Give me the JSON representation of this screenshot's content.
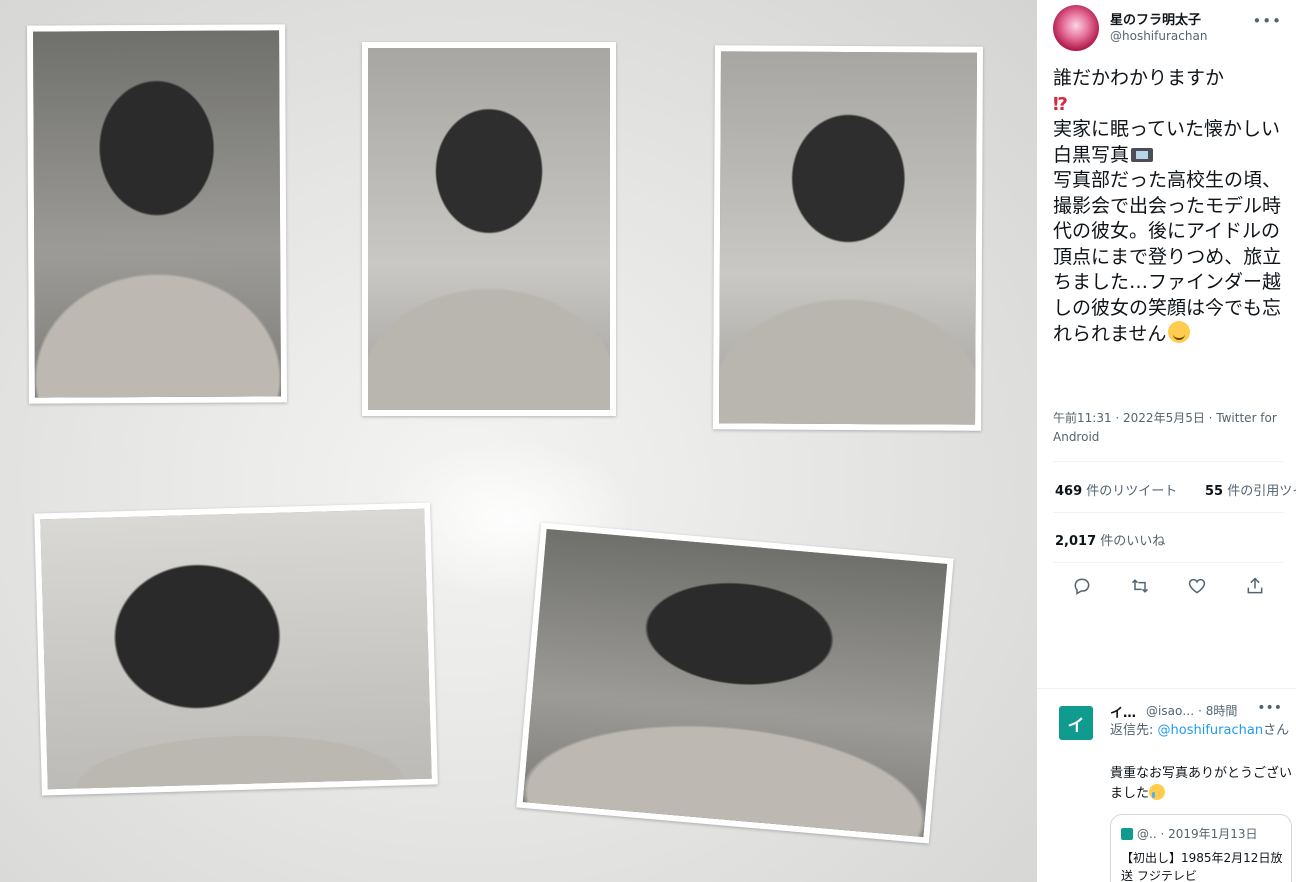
{
  "tweet": {
    "display_name": "星のフラ明太子",
    "handle": "@hoshifurachan",
    "text_part1": "誰だかわかりますか",
    "emoji_interrobang": "⁉",
    "text_part2": "実家に眠っていた懐かしい白黒写真",
    "text_part3": "写真部だった高校生の頃、撮影会で出会ったモデル時代の彼女。後にアイドルの頂点にまで登りつめ、旅立ちました…ファインダー越しの彼女の笑顔は今でも忘れられません",
    "timestamp": "午前11:31 · 2022年5月5日 · Twitter for Android",
    "retweet_count": "469",
    "retweet_label": " 件のリツイート",
    "quote_count": "55",
    "quote_label": " 件の引用ツイート",
    "like_count": "2,017",
    "like_label": " 件のいいね"
  },
  "reply": {
    "avatar_glyph": "イ",
    "name": "イ…",
    "handle_time": "@isao… · 8時間",
    "reply_to_prefix": "返信先: ",
    "reply_to_handle": "@hoshifurachan",
    "reply_to_suffix": "さん",
    "text": "貴重なお写真ありがとうございました",
    "quote_head": "@.. · 2019年1月13日",
    "quote_text": "【初出し】1985年2月12日放送 フジテレビ"
  },
  "icons": {
    "more": "more-icon",
    "reply": "reply-icon",
    "retweet": "retweet-icon",
    "like": "like-icon",
    "share": "share-icon"
  },
  "colors": {
    "link": "#1d9bf0",
    "text": "#0f1419",
    "muted": "#536471"
  }
}
